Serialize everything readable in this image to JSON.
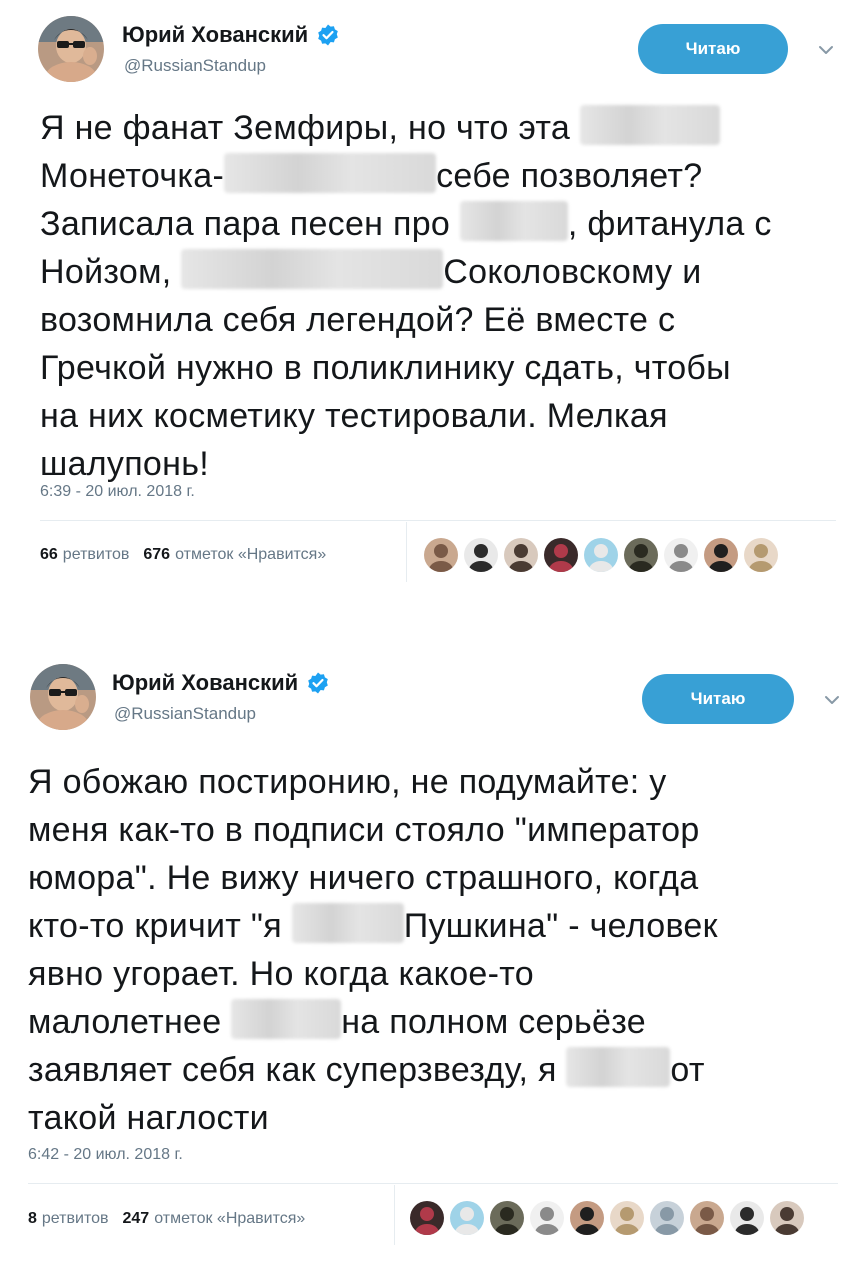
{
  "tweets": [
    {
      "author": {
        "name": "Юрий Хованский",
        "handle": "@RussianStandup",
        "verified": true,
        "avatar_icon": "user-avatar-photo"
      },
      "follow_button_label": "Читаю",
      "menu_icon": "chevron-down-icon",
      "text_lines": [
        [
          "Я не фанат Земфиры, но что эта ",
          "",
          ""
        ],
        [
          "Монеточка-",
          "",
          "себе позволяет?"
        ],
        [
          "Записала пара песен про ",
          "",
          ", фитанула с"
        ],
        [
          "Нойзом, ",
          "",
          "Соколовскому и"
        ],
        [
          "возомнила себя легендой? Её вместе с",
          "",
          ""
        ],
        [
          "Гречкой нужно в поликлинику сдать, чтобы",
          "",
          ""
        ],
        [
          "на них косметику тестировали. Мелкая",
          "",
          ""
        ],
        [
          "шалупонь!",
          "",
          ""
        ]
      ],
      "timestamp": "6:39 - 20 июл. 2018 г.",
      "retweets_count": "66",
      "retweets_label": "ретвитов",
      "likes_count": "676",
      "likes_label": "отметок «Нравится»",
      "liker_avatar_count": 9
    },
    {
      "author": {
        "name": "Юрий Хованский",
        "handle": "@RussianStandup",
        "verified": true,
        "avatar_icon": "user-avatar-photo"
      },
      "follow_button_label": "Читаю",
      "menu_icon": "chevron-down-icon",
      "text_lines": [
        [
          "Я обожаю постиронию, не подумайте: у",
          "",
          ""
        ],
        [
          "меня как-то в подписи стояло \"император",
          "",
          ""
        ],
        [
          "юмора\". Не вижу ничего страшного, когда",
          "",
          ""
        ],
        [
          "кто-то кричит \"я ",
          "",
          "Пушкина\" - человек"
        ],
        [
          "явно угорает. Но когда какое-то",
          "",
          ""
        ],
        [
          "малолетнее ",
          "",
          "на полном серьёзе"
        ],
        [
          "заявляет себя как суперзвезду, я ",
          "",
          "от"
        ],
        [
          "такой наглости",
          "",
          ""
        ]
      ],
      "timestamp": "6:42 - 20 июл. 2018 г.",
      "retweets_count": "8",
      "retweets_label": "ретвитов",
      "likes_count": "247",
      "likes_label": "отметок «Нравится»",
      "liker_avatar_count": 10
    }
  ],
  "colors": {
    "accent": "#38a0d5",
    "verified": "#1da1f2",
    "muted_text": "#657786",
    "main_text": "#14171a",
    "divider": "#e6ecf0"
  }
}
